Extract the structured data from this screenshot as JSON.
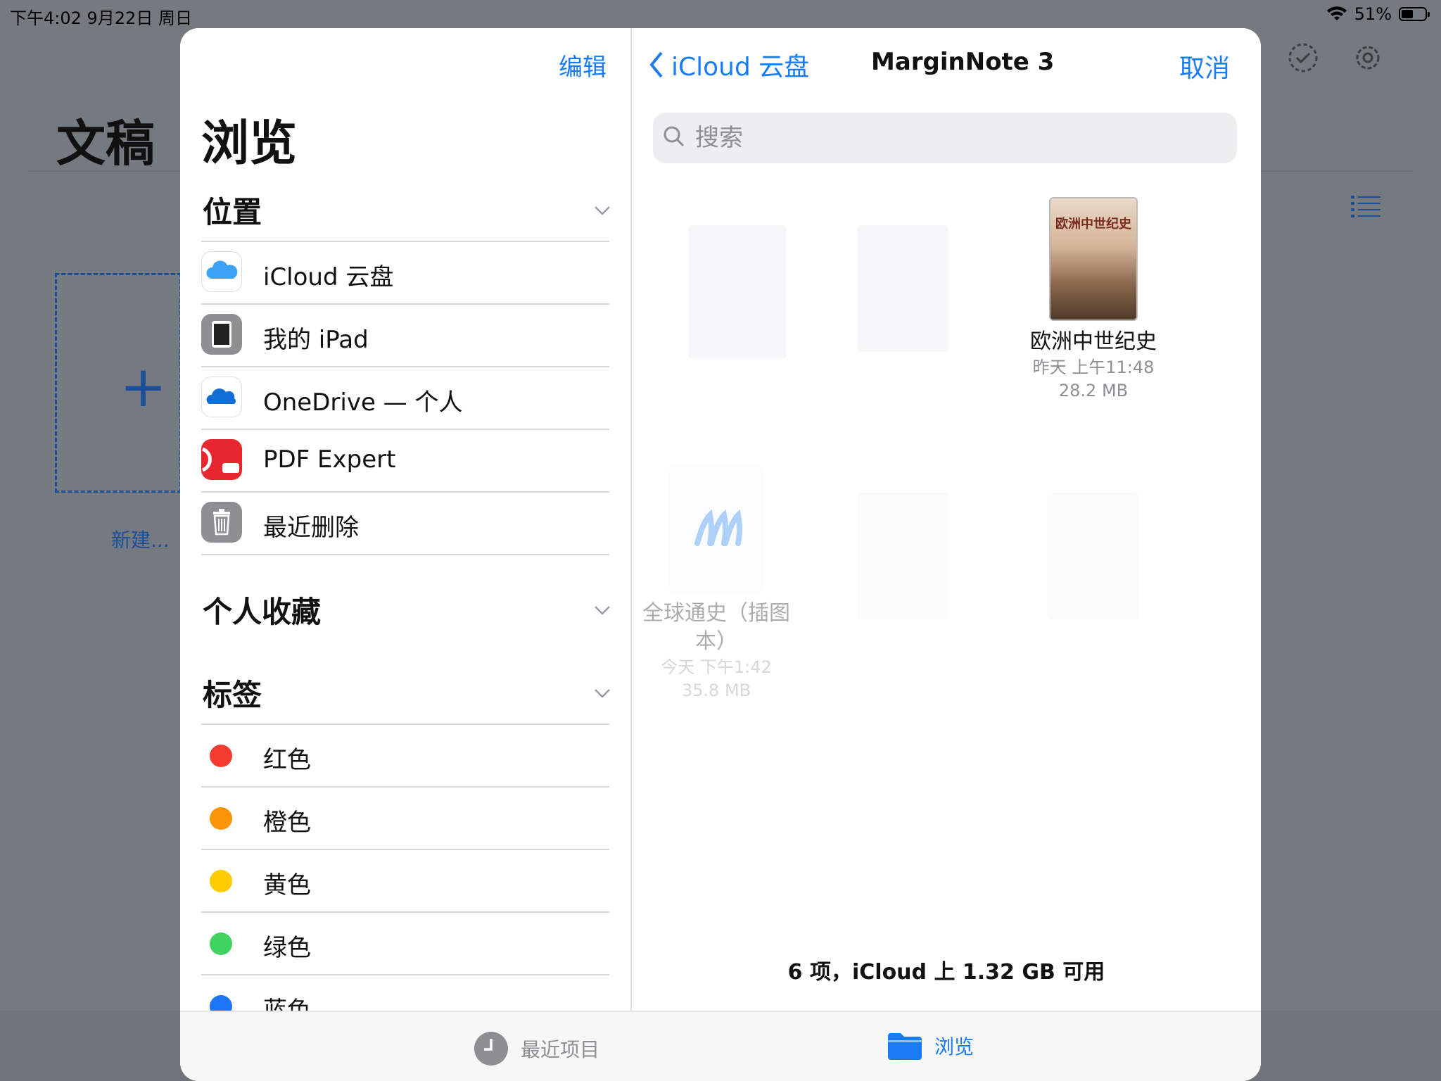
{
  "status_bar": {
    "time": "下午4:02   9月22日 周日",
    "battery": "51%",
    "battery_level": 0.51
  },
  "background_app": {
    "title": "文稿",
    "new_label": "新建..."
  },
  "sidebar": {
    "edit": "编辑",
    "title": "浏览",
    "sections": {
      "locations": "位置",
      "favorites": "个人收藏",
      "tags": "标签"
    },
    "locations": [
      {
        "label": "iCloud 云盘",
        "icon": "icloud-icon"
      },
      {
        "label": "我的 iPad",
        "icon": "ipad-icon"
      },
      {
        "label": "OneDrive — 个人",
        "icon": "onedrive-icon"
      },
      {
        "label": "PDF Expert",
        "icon": "pdf-expert-icon"
      },
      {
        "label": "最近删除",
        "icon": "trash-icon"
      }
    ],
    "tags": [
      {
        "label": "红色",
        "color": "#f43b30"
      },
      {
        "label": "橙色",
        "color": "#fb9404"
      },
      {
        "label": "黄色",
        "color": "#fecb00"
      },
      {
        "label": "绿色",
        "color": "#41d35f"
      },
      {
        "label": "蓝色",
        "color": "#1d74f6"
      }
    ]
  },
  "main": {
    "back": "iCloud 云盘",
    "title": "MarginNote 3",
    "cancel": "取消",
    "search_placeholder": "搜索",
    "files": [
      {
        "name": "欧洲中世纪史",
        "cover_title": "欧洲中世纪史",
        "date": "昨天 上午11:48",
        "size": "28.2 MB"
      },
      {
        "name": "全球通史（插图本）",
        "date": "今天 下午1:42",
        "size": "35.8 MB"
      }
    ],
    "footer": "6 项，iCloud 上 1.32 GB 可用"
  },
  "tabbar": {
    "recent": "最近项目",
    "browse": "浏览"
  },
  "accent_color": "#1a7cf5"
}
